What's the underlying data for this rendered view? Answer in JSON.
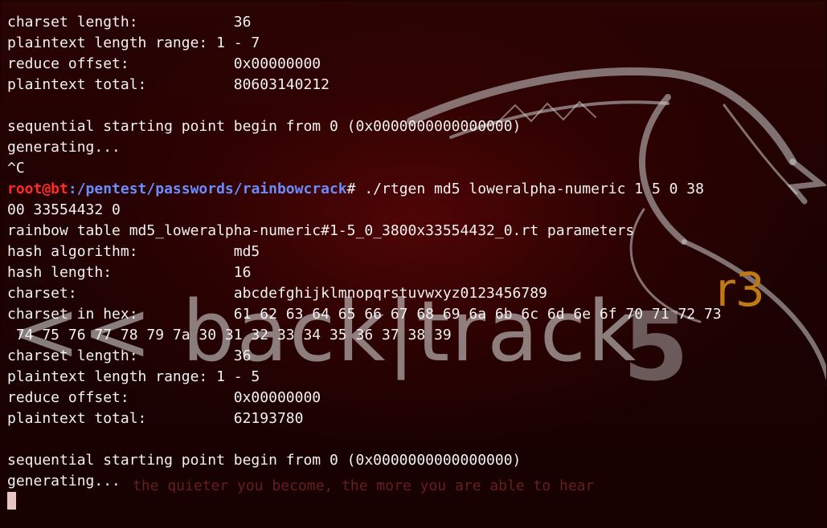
{
  "wallpaper": {
    "brand_text": "<< back|track",
    "brand_version": "5",
    "brand_release": "r3",
    "tagline": "the quieter you become, the more you are able to hear"
  },
  "terminal": {
    "prompt": {
      "user_host": "root@bt",
      "separator": ":",
      "path": "/pentest/passwords/rainbowcrack",
      "symbol": "# ",
      "command": "./rtgen md5 loweralpha-numeric 1 5 0 38",
      "command_wrap": "00 33554432 0"
    },
    "lines_before": [
      "charset length:           36",
      "plaintext length range: 1 - 7",
      "reduce offset:            0x00000000",
      "plaintext total:          80603140212",
      "",
      "sequential starting point begin from 0 (0x0000000000000000)",
      "generating...",
      "^C"
    ],
    "lines_after": [
      "rainbow table md5_loweralpha-numeric#1-5_0_3800x33554432_0.rt parameters",
      "hash algorithm:           md5",
      "hash length:              16",
      "charset:                  abcdefghijklmnopqrstuvwxyz0123456789",
      "charset in hex:           61 62 63 64 65 66 67 68 69 6a 6b 6c 6d 6e 6f 70 71 72 73",
      " 74 75 76 77 78 79 7a 30 31 32 33 34 35 36 37 38 39",
      "charset length:           36",
      "plaintext length range: 1 - 5",
      "reduce offset:            0x00000000",
      "plaintext total:          62193780",
      "",
      "sequential starting point begin from 0 (0x0000000000000000)",
      "generating..."
    ]
  },
  "colors": {
    "background": "#1e0202",
    "text": "#f2f2f2",
    "prompt_user": "#ff2a2a",
    "prompt_path": "#6b8cff",
    "brand_release": "#c07a14"
  },
  "icons": {
    "wallpaper": "dragon-icon",
    "cursor": "block-cursor"
  }
}
